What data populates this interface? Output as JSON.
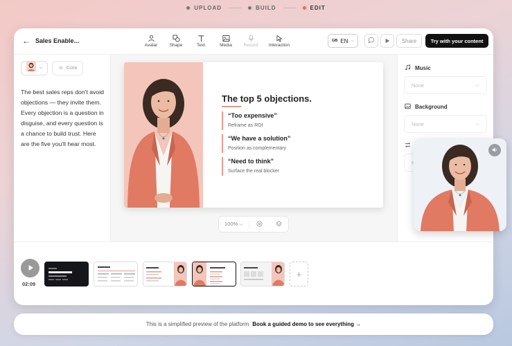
{
  "stepper": {
    "steps": [
      {
        "label": "UPLOAD",
        "state": "done"
      },
      {
        "label": "BUILD",
        "state": "done"
      },
      {
        "label": "EDIT",
        "state": "active"
      }
    ]
  },
  "topbar": {
    "back_icon": "arrow-left-icon",
    "title": "Sales Enable...",
    "tools": [
      {
        "label": "Avatar",
        "icon": "person-icon",
        "enabled": true
      },
      {
        "label": "Shape",
        "icon": "shapes-icon",
        "enabled": true
      },
      {
        "label": "Text",
        "icon": "text-icon",
        "enabled": true
      },
      {
        "label": "Media",
        "icon": "image-icon",
        "enabled": true
      },
      {
        "label": "Record",
        "icon": "microphone-icon",
        "enabled": false
      },
      {
        "label": "Interaction",
        "icon": "cursor-icon",
        "enabled": true
      }
    ],
    "language": {
      "flag": "GB",
      "code": "EN"
    },
    "share_label": "Share",
    "cta_label": "Try with your content"
  },
  "left_panel": {
    "voice_label": "Cora",
    "script": "The best sales reps don't avoid objections — they invite them. Every objection is a question in disguise, and every question is a chance to build trust. Here are the five you'll hear most."
  },
  "slide": {
    "title": "The top 5 objections.",
    "objections": [
      {
        "heading": "“Too expensive”",
        "sub": "Reframe as ROI"
      },
      {
        "heading": "“We have a solution”",
        "sub": "Position as complementary"
      },
      {
        "heading": "“Need to think”",
        "sub": "Surface the real blocker"
      }
    ],
    "accent_color": "#e8998f"
  },
  "zoom": {
    "value": "100%"
  },
  "right_panel": {
    "music_label": "Music",
    "music_value": "None",
    "background_label": "Background",
    "background_value": "None",
    "third_label": "S",
    "third_value": "N"
  },
  "timeline": {
    "time": "02:09",
    "add_label": "+"
  },
  "banner": {
    "text": "This is a simplified preview of the platform",
    "cta": "Book a guided demo to see everything →"
  },
  "colors": {
    "primary_button": "#111111",
    "accent": "#e66b5b",
    "blazer": "#e07a63"
  }
}
